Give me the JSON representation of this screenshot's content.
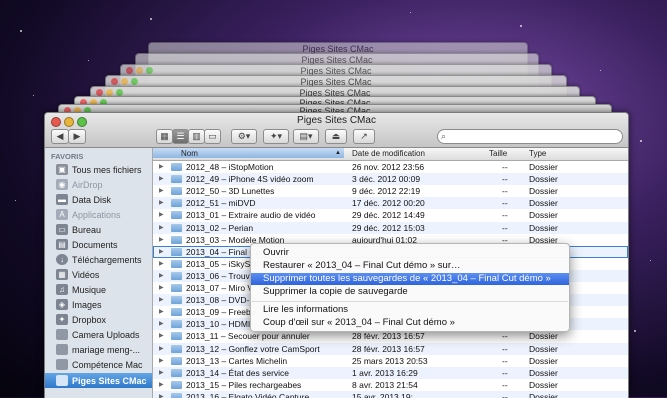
{
  "window_title": "Piges Sites CMac",
  "ghost_titles": [
    "Piges Sites CMac",
    "Piges Sites CMac",
    "Piges Sites CMac",
    "Piges Sites CMac",
    "Piges Sites CMac",
    "Piges Sites CMac",
    "Piges Sites CMac"
  ],
  "search": {
    "placeholder": ""
  },
  "sidebar": {
    "heading": "FAVORIS",
    "items": [
      {
        "label": "Tous mes fichiers",
        "icon": "all-files-icon"
      },
      {
        "label": "AirDrop",
        "icon": "airdrop-icon"
      },
      {
        "label": "Data Disk",
        "icon": "disk-icon"
      },
      {
        "label": "Applications",
        "icon": "applications-icon"
      },
      {
        "label": "Bureau",
        "icon": "desktop-icon"
      },
      {
        "label": "Documents",
        "icon": "documents-icon"
      },
      {
        "label": "Téléchargements",
        "icon": "downloads-icon"
      },
      {
        "label": "Vidéos",
        "icon": "movies-icon"
      },
      {
        "label": "Musique",
        "icon": "music-icon"
      },
      {
        "label": "Images",
        "icon": "pictures-icon"
      },
      {
        "label": "Dropbox",
        "icon": "dropbox-icon"
      },
      {
        "label": "Camera Uploads",
        "icon": "folder-icon"
      },
      {
        "label": "mariage meng-...",
        "icon": "folder-icon"
      },
      {
        "label": "Compétence Mac",
        "icon": "folder-icon"
      },
      {
        "label": "Piges Sites CMac",
        "icon": "folder-icon"
      }
    ]
  },
  "columns": {
    "name": "Nom",
    "date": "Date de modification",
    "size": "Taille",
    "type": "Type"
  },
  "rows": [
    {
      "name": "2012_48 – iStopMotion",
      "date": "26 nov. 2012 23:56",
      "size": "--",
      "type": "Dossier"
    },
    {
      "name": "2012_49 – iPhone 4S vidéo zoom",
      "date": "3 déc. 2012 00:09",
      "size": "--",
      "type": "Dossier"
    },
    {
      "name": "2012_50 – 3D Lunettes",
      "date": "9 déc. 2012 22:19",
      "size": "--",
      "type": "Dossier"
    },
    {
      "name": "2012_51 – miDVD",
      "date": "17 déc. 2012 00:20",
      "size": "--",
      "type": "Dossier"
    },
    {
      "name": "2013_01 – Extraire audio de vidéo",
      "date": "29 déc. 2012 14:49",
      "size": "--",
      "type": "Dossier"
    },
    {
      "name": "2013_02 – Perian",
      "date": "29 déc. 2012 15:03",
      "size": "--",
      "type": "Dossier"
    },
    {
      "name": "2013_03 – Modèle Motion",
      "date": "aujourd'hui 01:02",
      "size": "--",
      "type": "Dossier"
    },
    {
      "name": "2013_04 – Final Cu",
      "date": "",
      "size": "",
      "type": ""
    },
    {
      "name": "2013_05 – iSkySol",
      "date": "",
      "size": "",
      "type": ""
    },
    {
      "name": "2013_06 – Trouve",
      "date": "",
      "size": "",
      "type": ""
    },
    {
      "name": "2013_07 – Miro V",
      "date": "",
      "size": "",
      "type": ""
    },
    {
      "name": "2013_08 – DVD-R",
      "date": "",
      "size": "",
      "type": ""
    },
    {
      "name": "2013_09 – Freebo",
      "date": "",
      "size": "",
      "type": ""
    },
    {
      "name": "2013_10 – HDMI",
      "date": "",
      "size": "",
      "type": ""
    },
    {
      "name": "2013_11 – Secouer pour annuler",
      "date": "28 févr. 2013 16:57",
      "size": "--",
      "type": "Dossier"
    },
    {
      "name": "2013_12 – Gonflez votre CamSport",
      "date": "28 févr. 2013 16:57",
      "size": "--",
      "type": "Dossier"
    },
    {
      "name": "2013_13 – Cartes Michelin",
      "date": "25 mars 2013 20:53",
      "size": "--",
      "type": "Dossier"
    },
    {
      "name": "2013_14 – État des service",
      "date": "1 avr. 2013 16:29",
      "size": "--",
      "type": "Dossier"
    },
    {
      "name": "2013_15 – Piles rechargeabes",
      "date": "8 avr. 2013 21:54",
      "size": "--",
      "type": "Dossier"
    },
    {
      "name": "2013_16 – Elgato Vidéo Capture",
      "date": "15 avr. 2013 19:...",
      "size": "--",
      "type": "Dossier"
    }
  ],
  "context_menu": {
    "items": [
      {
        "label": "Ouvrir"
      },
      {
        "label": "Restaurer « 2013_04 – Final Cut démo » sur…"
      },
      {
        "label": "Supprimer toutes les sauvegardes de « 2013_04 – Final Cut démo »"
      },
      {
        "label": "Supprimer la copie de sauvegarde"
      },
      {
        "label": "Lire les informations"
      },
      {
        "label": "Coup d'œil sur « 2013_04 – Final Cut démo »"
      }
    ]
  }
}
